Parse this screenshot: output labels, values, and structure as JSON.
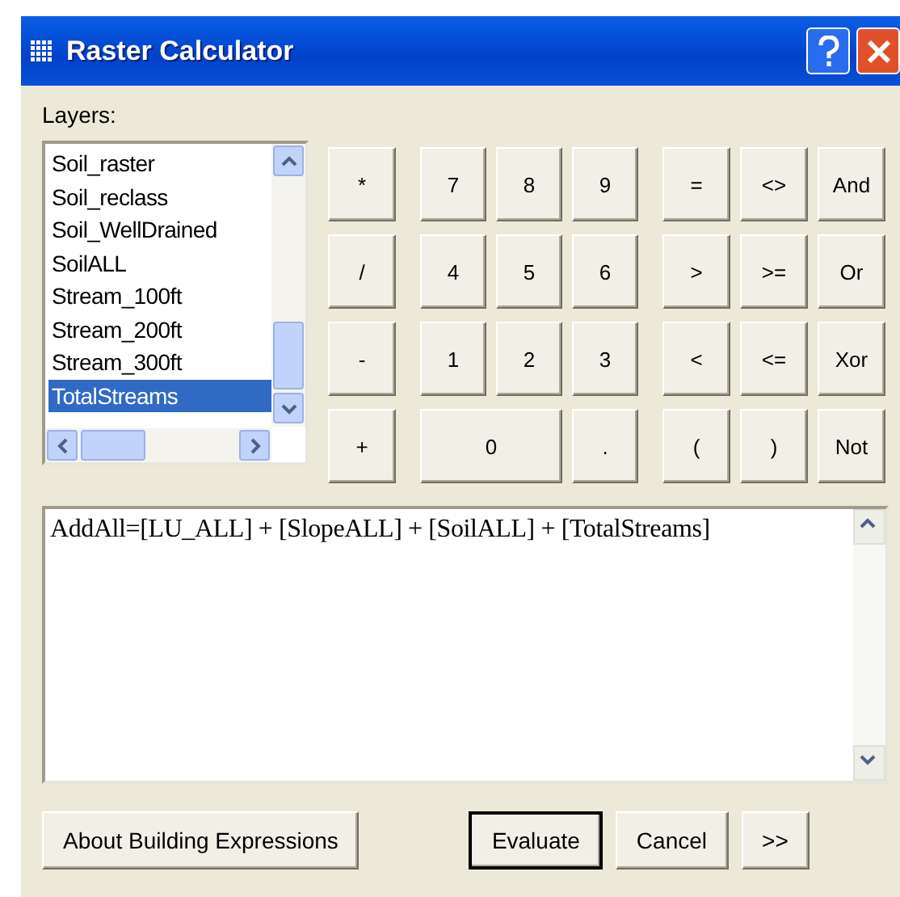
{
  "window": {
    "title": "Raster Calculator"
  },
  "layers": {
    "label": "Layers:",
    "items": [
      {
        "name": "Soil_raster",
        "selected": false
      },
      {
        "name": "Soil_reclass",
        "selected": false
      },
      {
        "name": "Soil_WellDrained",
        "selected": false
      },
      {
        "name": "SoilALL",
        "selected": false
      },
      {
        "name": "Stream_100ft",
        "selected": false
      },
      {
        "name": "Stream_200ft",
        "selected": false
      },
      {
        "name": "Stream_300ft",
        "selected": false
      },
      {
        "name": "TotalStreams",
        "selected": true
      }
    ]
  },
  "keypad": [
    {
      "kind": "operators",
      "keys": [
        {
          "label": "*",
          "wide": false
        },
        {
          "label": "/",
          "wide": false
        },
        {
          "label": "-",
          "wide": false
        },
        {
          "label": "+",
          "wide": false
        }
      ]
    },
    {
      "kind": "digits",
      "keys": [
        {
          "label": "7",
          "wide": false
        },
        {
          "label": "8",
          "wide": false
        },
        {
          "label": "9",
          "wide": false
        },
        {
          "label": "4",
          "wide": false
        },
        {
          "label": "5",
          "wide": false
        },
        {
          "label": "6",
          "wide": false
        },
        {
          "label": "1",
          "wide": false
        },
        {
          "label": "2",
          "wide": false
        },
        {
          "label": "3",
          "wide": false
        },
        {
          "label": "0",
          "wide": true
        },
        {
          "label": ".",
          "wide": false
        }
      ]
    },
    {
      "kind": "logic",
      "keys": [
        {
          "label": "=",
          "wide": false
        },
        {
          "label": "<>",
          "wide": false
        },
        {
          "label": "And",
          "wide": false
        },
        {
          "label": ">",
          "wide": false
        },
        {
          "label": ">=",
          "wide": false
        },
        {
          "label": "Or",
          "wide": false
        },
        {
          "label": "<",
          "wide": false
        },
        {
          "label": "<=",
          "wide": false
        },
        {
          "label": "Xor",
          "wide": false
        },
        {
          "label": "(",
          "wide": false
        },
        {
          "label": ")",
          "wide": false
        },
        {
          "label": "Not",
          "wide": false
        }
      ]
    }
  ],
  "expression": {
    "value": "AddAll=[LU_ALL] + [SlopeALL] + [SoilALL] + [TotalStreams]"
  },
  "buttons": [
    {
      "label": "About Building Expressions",
      "default": false
    },
    {
      "label": "Evaluate",
      "default": true
    },
    {
      "label": "Cancel",
      "default": false
    },
    {
      "label": ">>",
      "default": false
    }
  ]
}
